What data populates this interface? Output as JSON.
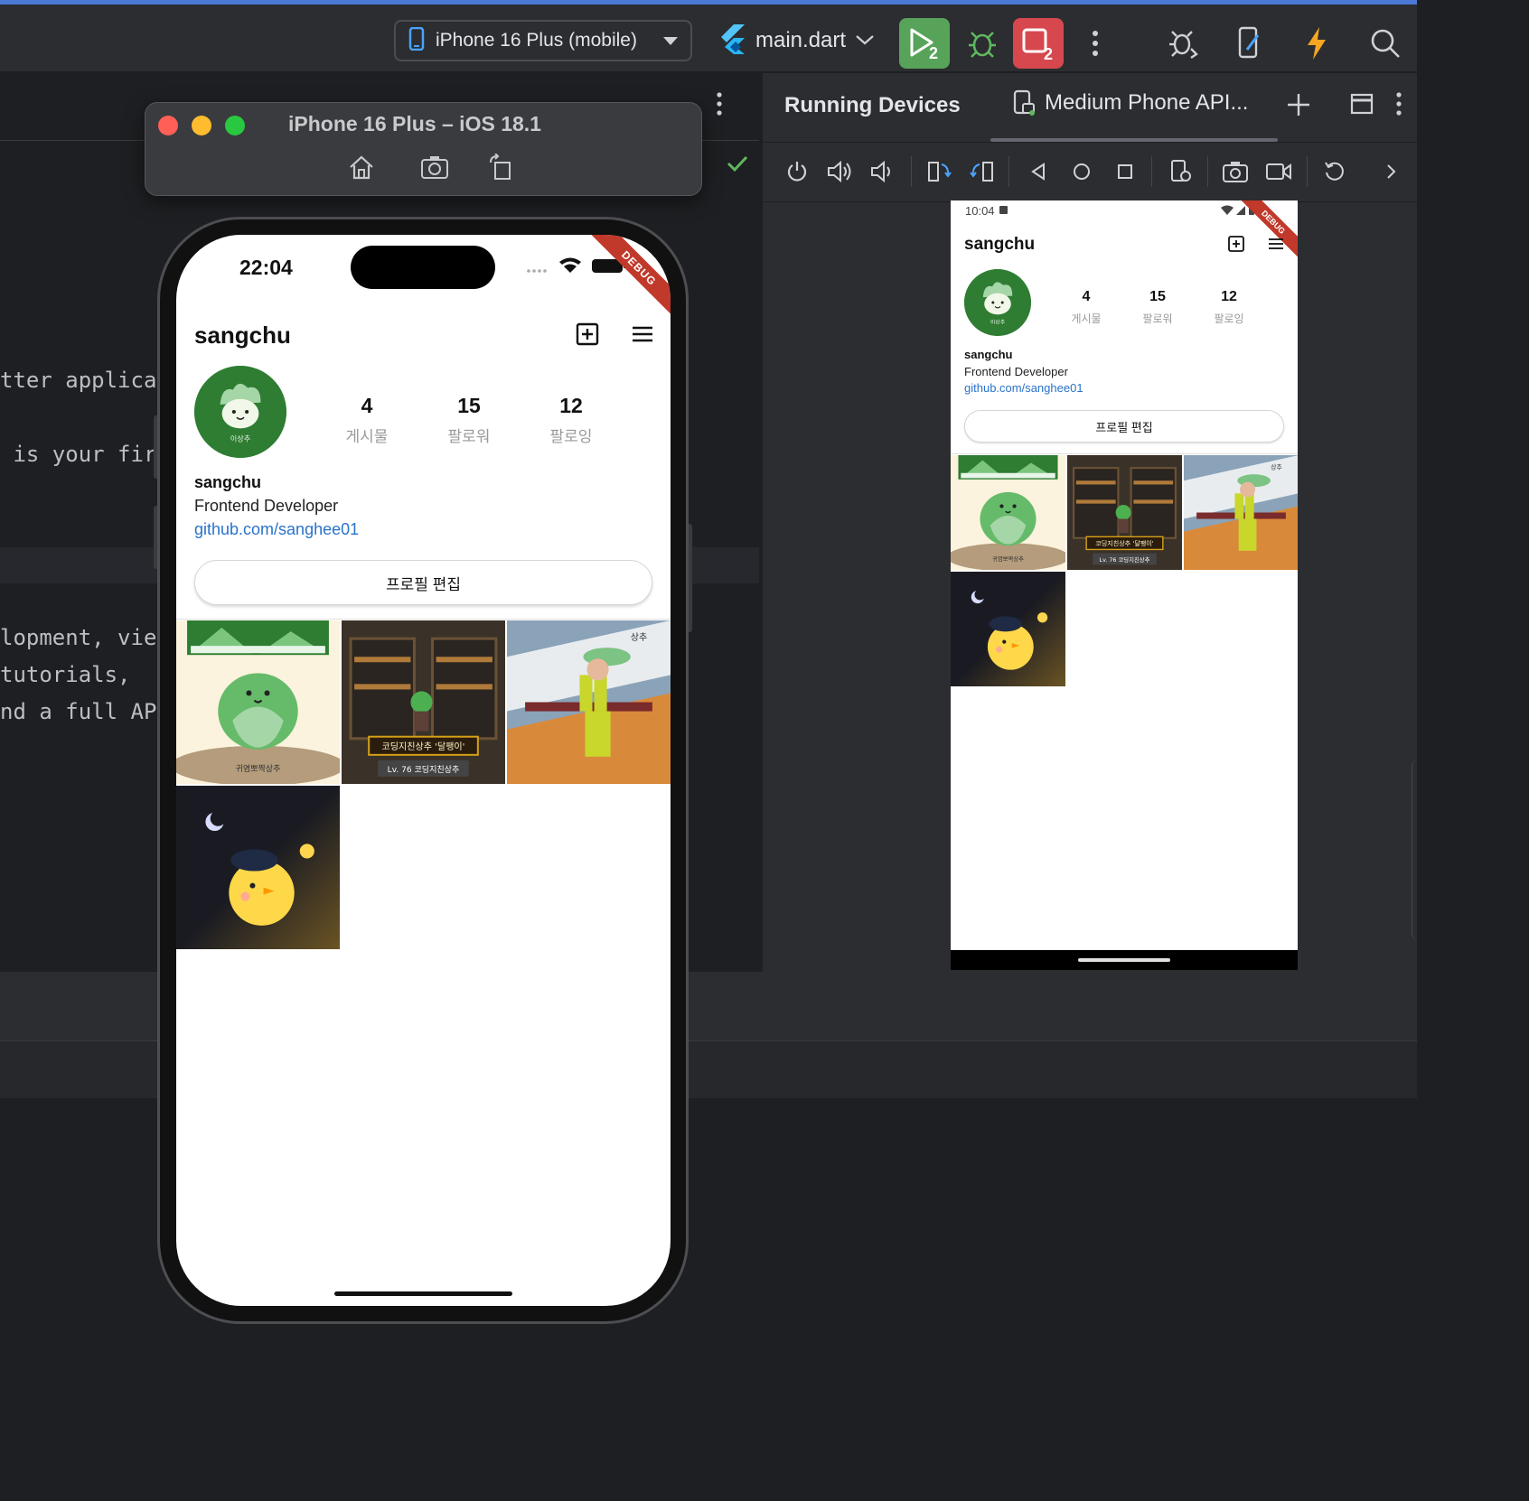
{
  "toolbar": {
    "device_selector": "iPhone 16 Plus (mobile)",
    "run_config": "main.dart",
    "icons": [
      "phone-icon",
      "flutter-icon",
      "run-icon",
      "debug-icon",
      "stop-icon",
      "more-icon",
      "attach-debugger-icon",
      "device-manager-icon",
      "hot-reload-icon",
      "search-icon"
    ]
  },
  "editor": {
    "lines": [
      "tter applica",
      " is your fir",
      "lopment, vie",
      "tutorials,",
      "nd a full AP"
    ]
  },
  "running_devices": {
    "title": "Running Devices",
    "tab_label": "Medium Phone API...",
    "tools": [
      "power-icon",
      "volume-up-icon",
      "volume-down-icon",
      "rotate-left-icon",
      "rotate-right-icon",
      "back-icon",
      "home-icon",
      "overview-icon",
      "settings-icon",
      "screenshot-icon",
      "screen-record-icon",
      "reset-icon",
      "chevron-right-icon"
    ]
  },
  "simulator": {
    "title": "iPhone 16 Plus – iOS 18.1",
    "tools": [
      "home-icon",
      "screenshot-icon",
      "rotate-icon"
    ]
  },
  "iphone": {
    "time": "22:04",
    "debug_banner": "DEBUG"
  },
  "android": {
    "time": "10:04",
    "debug_banner": "DEBUG"
  },
  "profile": {
    "username": "sangchu",
    "stats": [
      {
        "value": "4",
        "label": "게시물"
      },
      {
        "value": "15",
        "label": "팔로워"
      },
      {
        "value": "12",
        "label": "팔로잉"
      }
    ],
    "name": "sangchu",
    "bio": "Frontend Developer",
    "link": "github.com/sanghee01",
    "edit_button": "프로필 편집",
    "avatar_caption": "이상추",
    "posts": [
      {
        "kind": "cabbage",
        "caption": "귀염뽀짝상추"
      },
      {
        "kind": "game",
        "caption": "코딩지친상추 '달팽이'",
        "caption2": "Lv. 76  코딩지친상추"
      },
      {
        "kind": "figure",
        "caption": "상추"
      },
      {
        "kind": "chick"
      }
    ]
  },
  "colors": {
    "ide_bg": "#1e1f22",
    "ide_panel": "#2b2d30",
    "run_green": "#58a35a",
    "stop_red": "#d6484d",
    "avatar_green": "#2e7d32",
    "link_blue": "#2a73c9",
    "debug_red": "#c0392b"
  }
}
